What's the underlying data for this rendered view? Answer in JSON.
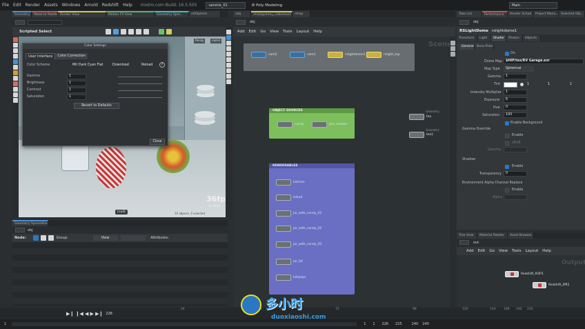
{
  "menu": [
    "File",
    "Edit",
    "Render",
    "Assets",
    "Windows",
    "Arnold",
    "Redshift",
    "Help"
  ],
  "app_info": "mixtm.com  Build: 16.5.505",
  "desktop_field": "vanmix_01",
  "desktop_label": "Poly Modeling",
  "main_label": "Main",
  "left_tabs": [
    "Geometry Spre...",
    "Material Palette",
    "Render View",
    "Motion FX View",
    "Geometry Spre...",
    "mtlSphere"
  ],
  "scene_tabs": [
    "/obj",
    "/mat/gummy_coberbox1",
    "/shop"
  ],
  "scene_path": "obj",
  "scene_menu": [
    "Add",
    "Edit",
    "Go",
    "View",
    "Tools",
    "Layout",
    "Help"
  ],
  "scene_watermark": "Scene",
  "top_nodes": [
    "cam2",
    "cam1",
    "rslightdome1",
    "rslight_top"
  ],
  "object_sources": {
    "title": "OBJECT SOURCES",
    "nodes": [
      "candy",
      "jars_master"
    ]
  },
  "renderables": {
    "title": "RENDERABLES",
    "nodes": [
      "kitchen",
      "island",
      "jar_with_candy_02",
      "jar_with_candy_02",
      "jar_with_candy_03",
      "jar_04",
      "lollipops"
    ]
  },
  "side_nodes": [
    {
      "label": "tex",
      "tag": "Geometry"
    },
    {
      "label": "tex1",
      "tag": "Geometry"
    }
  ],
  "viewport": {
    "header": "Scripted Select",
    "persp": "Persp",
    "cam": "cam1",
    "fps": "36fps",
    "time": "27.62ms",
    "status": "10 objects, 0 selected",
    "null_label": "(null)"
  },
  "color_dialog": {
    "title": "Color Settings",
    "tabs": [
      "User Interface",
      "Color Correction"
    ],
    "scheme_label": "Color Scheme",
    "scheme_value": "Mit Dark Cyan Flat",
    "download": "Download",
    "reload": "Reload",
    "rows": [
      {
        "label": "Gamma",
        "value": "1"
      },
      {
        "label": "Brightness",
        "value": "1"
      },
      {
        "label": "Contrast",
        "value": "1"
      },
      {
        "label": "Saturation",
        "value": "1"
      }
    ],
    "revert": "Revert to Defaults",
    "close": "Close"
  },
  "bottom_left": {
    "tab": "Geometry Spreadsheet",
    "path": "obj",
    "node_label": "Node:",
    "group_label": "Group:",
    "view_label": "View",
    "attributes_label": "Attributes:"
  },
  "props": {
    "tabs_top": [
      "Take List",
      "Performance",
      "Render Sched...",
      "Project Mana...",
      "Selected Obj..."
    ],
    "node_type": "RSLightDome",
    "node_name": "rslightdome1",
    "tabs": [
      "Transform",
      "Light",
      "Shader",
      "Photon",
      "Objects"
    ],
    "subtabs": [
      "General",
      "Back-Plate"
    ],
    "on_label": "On",
    "dome_map_label": "Dome Map",
    "dome_map_value": "$HIP/tex/RV Garage.exr",
    "map_type_label": "Map Type",
    "map_type_value": "Spherical",
    "gamma_label": "Gamma",
    "gamma_value": "1",
    "tint_label": "Tint",
    "tint_values": [
      "1",
      "1",
      "1"
    ],
    "intensity_label": "Intensity Multiplier",
    "intensity_value": "1",
    "exposure_label": "Exposure",
    "exposure_value": "6",
    "hue_label": "Hue",
    "hue_value": "0",
    "saturation_label": "Saturation",
    "saturation_value": "100",
    "enable_bg": "Enable Background",
    "gamma_override": "Gamma Override",
    "enable": "Enable",
    "srgb": "sRGB",
    "gamma2": "Gamma",
    "shadow": "Shadow",
    "transparency_label": "Transparency",
    "transparency_value": "0",
    "env_alpha": "Environment Alpha Channel Replace",
    "alpha": "Alpha"
  },
  "bottom_right": {
    "tabs": [
      "Tree View",
      "Material Palette",
      "Asset Browser"
    ],
    "path": "out",
    "menu": [
      "Add",
      "Edit",
      "Go",
      "View",
      "Tools",
      "Layout",
      "Help"
    ],
    "watermark": "Output",
    "nodes": [
      "Redshift_ROP1",
      "Redshift_IPR1"
    ]
  },
  "timeline": {
    "ticks": [
      "24",
      "48",
      "72",
      "96",
      "120",
      "144",
      "168",
      "192",
      "216",
      "240"
    ],
    "frame": "226",
    "start": "1",
    "end1": "240",
    "end2": "240",
    "range_fields": [
      "1",
      "1",
      "226",
      "225"
    ]
  },
  "watermark_text": "多小时",
  "watermark_url": "duoxiaoshi.com",
  "colors": {
    "accent_blue": "#2a78c4",
    "object_sources": "#7cbf5c",
    "renderables": "#6a6fc4",
    "camera_node": "#3b6fa0",
    "light_node": "#c9b040"
  }
}
